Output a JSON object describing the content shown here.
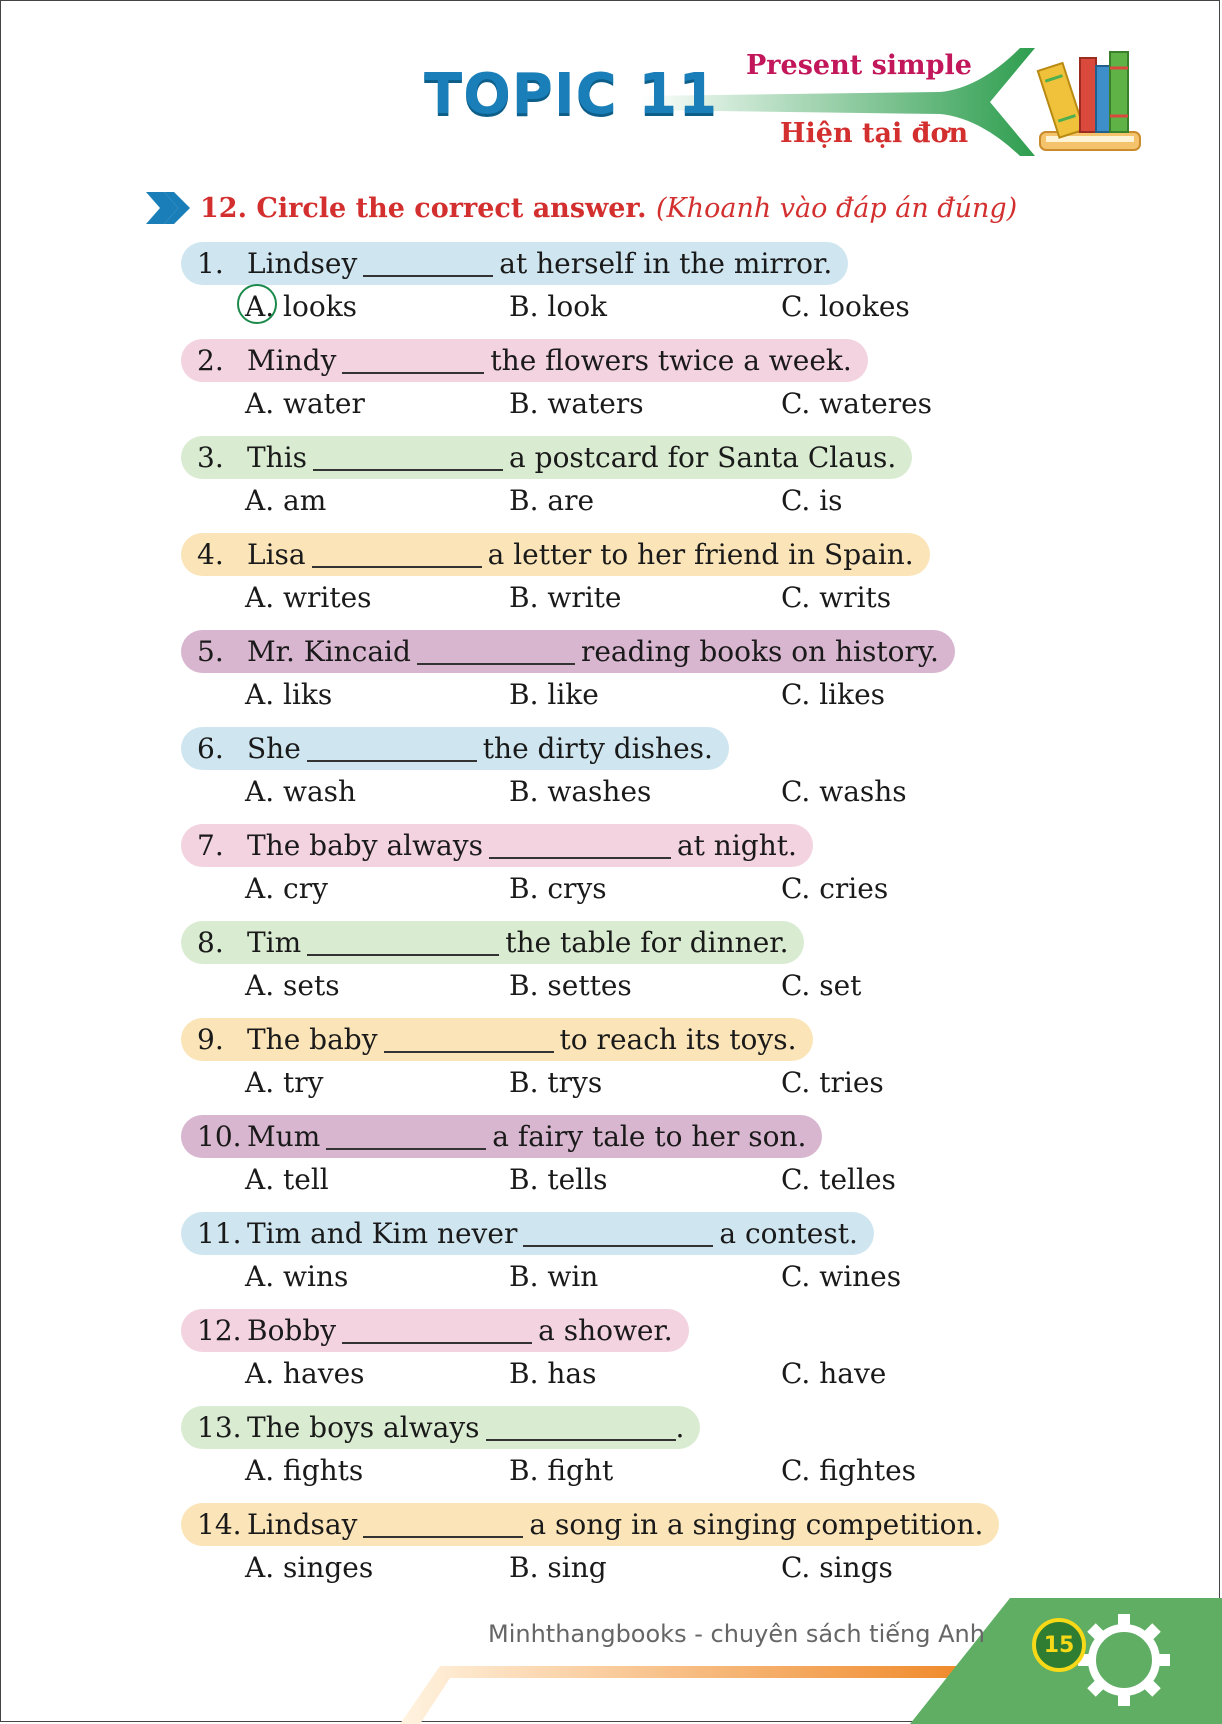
{
  "header": {
    "topic": "TOPIC 11",
    "subtitle_en": "Present simple",
    "subtitle_vi": "Hiện tại đơn"
  },
  "section": {
    "title": "12. Circle the correct answer.",
    "title_vi": "(Khoanh vào đáp án đúng)"
  },
  "colors": {
    "blue": "#cfe6f0",
    "pink": "#f3d3df",
    "green": "#d9ecd1",
    "yellow": "#fbe5b8",
    "purple": "#d8b6cf",
    "circle": "#1b8a4a",
    "topic": "#1a7fb8",
    "heading": "#d32f2f"
  },
  "questions": [
    {
      "num": "1.",
      "before": "Lindsey",
      "after": "at herself in the mirror.",
      "color": "#cfe6f0",
      "options": [
        "A. looks",
        "B. look",
        "C. lookes"
      ],
      "circled": "A."
    },
    {
      "num": "2.",
      "before": "Mindy",
      "after": "the flowers twice a week.",
      "color": "#f3d3df",
      "options": [
        "A. water",
        "B. waters",
        "C. wateres"
      ]
    },
    {
      "num": "3.",
      "before": "This",
      "after": "a postcard for Santa Claus.",
      "color": "#d9ecd1",
      "options": [
        "A. am",
        "B. are",
        "C. is"
      ]
    },
    {
      "num": "4.",
      "before": "Lisa",
      "after": "a letter to her friend in Spain.",
      "color": "#fbe5b8",
      "options": [
        "A. writes",
        "B. write",
        "C. writs"
      ]
    },
    {
      "num": "5.",
      "before": "Mr. Kincaid",
      "after": "reading books on history.",
      "color": "#d8b6cf",
      "options": [
        "A. liks",
        "B. like",
        "C. likes"
      ]
    },
    {
      "num": "6.",
      "before": "She",
      "after": "the dirty dishes.",
      "color": "#cfe6f0",
      "options": [
        "A. wash",
        "B. washes",
        "C. washs"
      ]
    },
    {
      "num": "7.",
      "before": "The baby always",
      "after": "at night.",
      "color": "#f3d3df",
      "options": [
        "A. cry",
        "B. crys",
        "C. cries"
      ]
    },
    {
      "num": "8.",
      "before": "Tim",
      "after": "the table for dinner.",
      "color": "#d9ecd1",
      "options": [
        "A. sets",
        "B. settes",
        "C. set"
      ]
    },
    {
      "num": "9.",
      "before": "The baby",
      "after": "to reach its toys.",
      "color": "#fbe5b8",
      "options": [
        "A. try",
        "B. trys",
        "C. tries"
      ]
    },
    {
      "num": "10.",
      "before": "Mum",
      "after": "a fairy tale to her son.",
      "color": "#d8b6cf",
      "options": [
        "A. tell",
        "B. tells",
        "C. telles"
      ]
    },
    {
      "num": "11.",
      "before": "Tim and Kim never",
      "after": "a contest.",
      "color": "#cfe6f0",
      "options": [
        "A. wins",
        "B. win",
        "C. wines"
      ]
    },
    {
      "num": "12.",
      "before": "Bobby",
      "after": "a shower.",
      "color": "#f3d3df",
      "options": [
        "A. haves",
        "B. has",
        "C. have"
      ]
    },
    {
      "num": "13.",
      "before": "The boys always",
      "after": ".",
      "color": "#d9ecd1",
      "options": [
        "A. fights",
        "B. fight",
        "C. fightes"
      ]
    },
    {
      "num": "14.",
      "before": "Lindsay",
      "after": "a song in a singing competition.",
      "color": "#fbe5b8",
      "options": [
        "A. singes",
        "B. sing",
        "C. sings"
      ]
    }
  ],
  "footer": {
    "text": "Minhthangbooks - chuyên sách tiếng Anh",
    "page_number": "15"
  }
}
